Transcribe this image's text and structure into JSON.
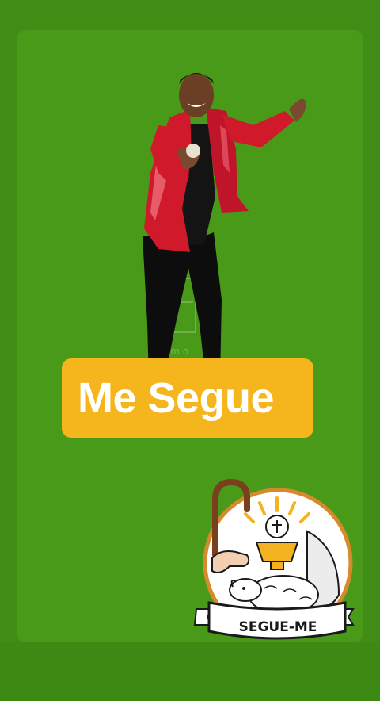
{
  "cta": {
    "label": "Me Segue"
  },
  "watermark": {
    "text": "em o"
  },
  "logo": {
    "ribbon_text": "SEGUE-ME"
  },
  "colors": {
    "background": "#3f8d14",
    "panel": "#4a9a1a",
    "cta_background": "#f5b51c",
    "cta_text": "#ffffff",
    "jacket": "#d0192b",
    "logo_ring": "#d78a2c"
  },
  "icons": [
    "dancer-figure",
    "shepherd-crook-icon",
    "chalice-icon",
    "lamb-icon"
  ]
}
